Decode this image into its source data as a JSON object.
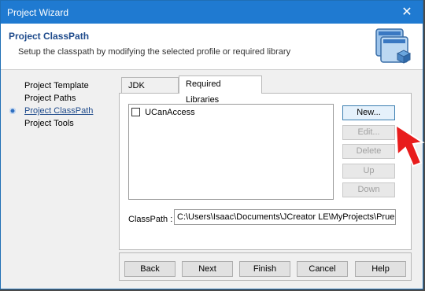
{
  "window": {
    "title": "Project Wizard",
    "close_glyph": "✕"
  },
  "header": {
    "title": "Project ClassPath",
    "subtitle": "Setup the classpath by modifying the selected profile or required library",
    "icon": "classpath-window-icon"
  },
  "nav": {
    "items": [
      {
        "label": "Project Template",
        "active": false
      },
      {
        "label": "Project Paths",
        "active": false
      },
      {
        "label": "Project ClassPath",
        "active": true
      },
      {
        "label": "Project Tools",
        "active": false
      }
    ]
  },
  "tabs": [
    {
      "label": "JDK Profiles",
      "selected": false
    },
    {
      "label": "Required Libraries",
      "selected": true
    }
  ],
  "libraries": [
    {
      "label": "UCanAccess",
      "checked": false
    }
  ],
  "side_buttons": {
    "new": "New...",
    "edit": "Edit...",
    "delete": "Delete",
    "up": "Up",
    "down": "Down"
  },
  "classpath": {
    "label": "ClassPath :",
    "value": "C:\\Users\\Isaac\\Documents\\JCreator LE\\MyProjects\\Prueba\\"
  },
  "footer": {
    "back": "Back",
    "next": "Next",
    "finish": "Finish",
    "cancel": "Cancel",
    "help": "Help"
  },
  "colors": {
    "titlebar": "#1f7ad1",
    "accent_arrow": "#e81c1c",
    "header_title": "#1f4b8c"
  }
}
